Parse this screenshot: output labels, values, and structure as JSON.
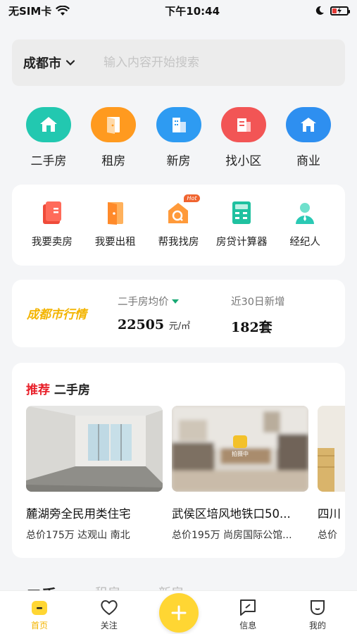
{
  "status_bar": {
    "carrier": "无SIM卡",
    "time": "下午10:44",
    "battery_color": "#e53935"
  },
  "search": {
    "city": "成都市",
    "placeholder": "输入内容开始搜索"
  },
  "main_categories": [
    {
      "label": "二手房",
      "icon": "house-icon",
      "color": "#22c8b0"
    },
    {
      "label": "租房",
      "icon": "door-icon",
      "color": "#ff9a1f"
    },
    {
      "label": "新房",
      "icon": "building-icon",
      "color": "#2e9bf2"
    },
    {
      "label": "找小区",
      "icon": "community-icon",
      "color": "#f25555"
    },
    {
      "label": "商业",
      "icon": "shop-icon",
      "color": "#2e8ff0"
    }
  ],
  "tools": [
    {
      "label": "我要卖房",
      "icon": "sell-house-icon",
      "color": "#ef4b3a"
    },
    {
      "label": "我要出租",
      "icon": "rent-out-icon",
      "color": "#ff8a2a"
    },
    {
      "label": "帮我找房",
      "icon": "find-house-icon",
      "color": "#ff8a2a",
      "badge": "Hot"
    },
    {
      "label": "房贷计算器",
      "icon": "calculator-icon",
      "color": "#1fc1a0"
    },
    {
      "label": "经纪人",
      "icon": "agent-icon",
      "color": "#2ac9b4"
    }
  ],
  "market": {
    "title": "成都市行情",
    "avg_price_label": "二手房均价",
    "avg_price": "22505",
    "avg_price_unit": "元/㎡",
    "new_label": "近30日新增",
    "new_count": "182套"
  },
  "recommend": {
    "tag": "推荐",
    "title": "二手房",
    "listings": [
      {
        "title": "麓湖旁全民用类住宅",
        "sub": "总价175万 达观山 南北"
      },
      {
        "title": "武侯区培风地铁口50...",
        "sub": "总价195万 尚房国际公馆...",
        "badge": "拍摄中"
      },
      {
        "title": "四川",
        "sub": "总价"
      }
    ]
  },
  "tabs_peek": [
    "二手",
    "租房",
    "新房"
  ],
  "bottom_nav": [
    {
      "label": "首页",
      "icon": "home-icon",
      "active": true
    },
    {
      "label": "关注",
      "icon": "heart-icon",
      "active": false
    },
    {
      "label": "信息",
      "icon": "message-icon",
      "active": false
    },
    {
      "label": "我的",
      "icon": "profile-icon",
      "active": false
    }
  ],
  "accent_color": "#f3b400"
}
